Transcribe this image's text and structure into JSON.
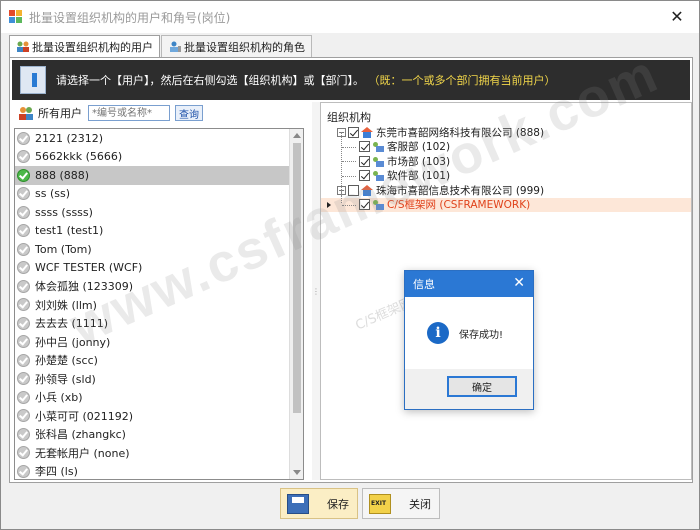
{
  "window": {
    "title": "批量设置组织机构的用户和角号(岗位)",
    "close_glyph": "✕"
  },
  "tabs": [
    {
      "label": "批量设置组织机构的用户",
      "active": true
    },
    {
      "label": "批量设置组织机构的角色",
      "active": false
    }
  ],
  "banner": {
    "text": "请选择一个【用户】，然后在右侧勾选【组织机构】或【部门】。",
    "hint": "（既：一个或多个部门拥有当前用户）"
  },
  "search": {
    "label": "所有用户",
    "placeholder": "*编号或名称*",
    "button": "查询"
  },
  "users": [
    {
      "text": "2121 (2312)",
      "checked": false
    },
    {
      "text": "5662kkk (5666)",
      "checked": false
    },
    {
      "text": "888 (888)",
      "checked": true,
      "selected": true
    },
    {
      "text": "ss (ss)",
      "checked": false
    },
    {
      "text": "ssss (ssss)",
      "checked": false
    },
    {
      "text": "test1 (test1)",
      "checked": false
    },
    {
      "text": "Tom (Tom)",
      "checked": false
    },
    {
      "text": "WCF TESTER (WCF)",
      "checked": false
    },
    {
      "text": "体会孤独 (123309)",
      "checked": false
    },
    {
      "text": "刘刘姝 (llm)",
      "checked": false
    },
    {
      "text": "去去去 (1111)",
      "checked": false
    },
    {
      "text": "孙中吕 (jonny)",
      "checked": false
    },
    {
      "text": "孙楚楚 (scc)",
      "checked": false
    },
    {
      "text": "孙领导 (sld)",
      "checked": false
    },
    {
      "text": "小兵 (xb)",
      "checked": false
    },
    {
      "text": "小菜可可 (021192)",
      "checked": false
    },
    {
      "text": "张科昌 (zhangkc)",
      "checked": false
    },
    {
      "text": "无套帐用户 (none)",
      "checked": false
    },
    {
      "text": "李四 (ls)",
      "checked": false
    }
  ],
  "org": {
    "header": "组织机构",
    "nodes": [
      {
        "text": "东莞市喜韶网络科技有限公司 (888)",
        "level": 0,
        "checked": true,
        "expanded": true,
        "icon": "house-icon"
      },
      {
        "text": "客服部 (102)",
        "level": 1,
        "checked": true,
        "icon": "department-icon"
      },
      {
        "text": "市场部 (103)",
        "level": 1,
        "checked": true,
        "icon": "department-icon"
      },
      {
        "text": "软件部 (101)",
        "level": 1,
        "checked": true,
        "icon": "department-icon"
      },
      {
        "text": "珠海市喜韶信息技术有限公司 (999)",
        "level": 0,
        "checked": false,
        "expanded": true,
        "icon": "house-icon"
      },
      {
        "text": "C/S框架网 (CSFRAMEWORK)",
        "level": 1,
        "checked": true,
        "selected": true,
        "icon": "department-icon"
      }
    ]
  },
  "watermark": {
    "text": "www.csframework.com",
    "sub": "C/S框架网"
  },
  "dialog": {
    "title": "信息",
    "message": "保存成功!",
    "ok": "确定",
    "close_glyph": "✕"
  },
  "footer": {
    "save": "保存",
    "close": "关闭"
  },
  "colors": {
    "banner_bg": "#2d2d2d",
    "banner_hint": "#f1d64a",
    "dialog_accent": "#2b78d4",
    "selected_node": "#e0421b"
  }
}
